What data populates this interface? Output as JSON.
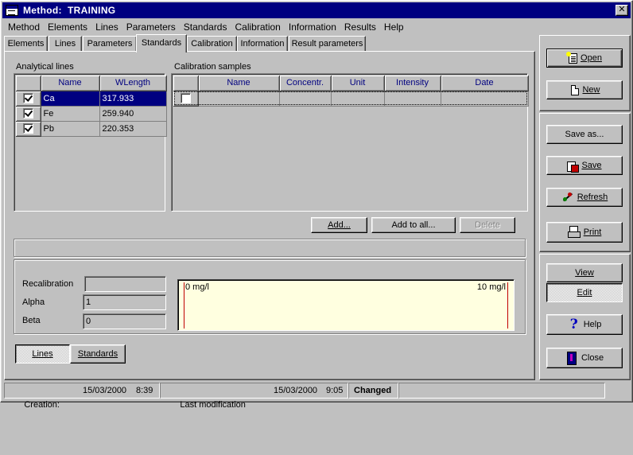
{
  "window": {
    "title": "Method:  TRAINING",
    "close_glyph": "✕"
  },
  "menu": [
    "Method",
    "Elements",
    "Lines",
    "Parameters",
    "Standards",
    "Calibration",
    "Information",
    "Results",
    "Help"
  ],
  "tabs": [
    {
      "label": "Elements",
      "active": false
    },
    {
      "label": "Lines",
      "active": false
    },
    {
      "label": "Parameters",
      "active": false
    },
    {
      "label": "Standards",
      "active": true
    },
    {
      "label": "Calibration",
      "active": false
    },
    {
      "label": "Information",
      "active": false
    },
    {
      "label": "Result parameters",
      "active": false
    }
  ],
  "analytical_lines": {
    "title": "Analytical lines",
    "columns": [
      "Name",
      "WLength"
    ],
    "rows": [
      {
        "checked": true,
        "name": "Ca",
        "wlength": "317.933",
        "selected": true
      },
      {
        "checked": true,
        "name": "Fe",
        "wlength": "259.940",
        "selected": false
      },
      {
        "checked": true,
        "name": "Pb",
        "wlength": "220.353",
        "selected": false
      }
    ]
  },
  "calibration_samples": {
    "title": "Calibration samples",
    "columns": [
      "Name",
      "Concentr.",
      "Unit",
      "Intensity",
      "Date"
    ],
    "rows": [
      {
        "checked": false,
        "name": "",
        "concentration": "",
        "unit": "",
        "intensity": "",
        "date": ""
      }
    ]
  },
  "sample_buttons": {
    "add": "Add...",
    "add_to_all": "Add to all...",
    "delete": "Delete"
  },
  "recalibration": {
    "recalibration_label": "Recalibration",
    "recalibration_value": "",
    "alpha_label": "Alpha",
    "alpha_value": "1",
    "beta_label": "Beta",
    "beta_value": "0",
    "range_min": "0 mg/l",
    "range_max": "10 mg/l"
  },
  "view_toggle": {
    "lines": "Lines",
    "standards": "Standards",
    "active": "Lines"
  },
  "side_buttons": {
    "open": "Open",
    "new": "New",
    "save_as": "Save as...",
    "save": "Save",
    "refresh": "Refresh",
    "print": "Print",
    "view": "View",
    "edit": "Edit",
    "help": "Help",
    "close": "Close"
  },
  "status": {
    "creation_label": "Creation:",
    "creation_date": "15/03/2000",
    "creation_time": "8:39",
    "modification_label": "Last modification",
    "modification_date": "15/03/2000",
    "modification_time": "9:05",
    "state": "Changed"
  },
  "colors": {
    "titlebar": "#000080",
    "face": "#c0c0c0",
    "selection": "#000080",
    "header_text": "#000080",
    "graph_bg": "#ffffe0",
    "graph_marker": "#c00000"
  }
}
